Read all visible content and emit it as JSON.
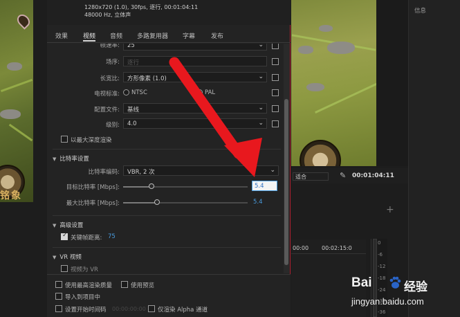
{
  "source_info": {
    "line1": "1280x720 (1.0), 30fps, 逐行, 00:01:04:11",
    "line2": "48000 Hz, 立体声"
  },
  "tabs": [
    "效果",
    "视频",
    "音频",
    "多路复用器",
    "字幕",
    "发布"
  ],
  "active_tab": "视频",
  "video": {
    "frame_rate_label": "帧速率:",
    "frame_rate_value": "25",
    "field_order_label": "场序:",
    "field_order_value": "逐行",
    "aspect_label": "长宽比:",
    "aspect_value": "方形像素 (1.0)",
    "tv_standard_label": "电视标准:",
    "ntsc": "NTSC",
    "pal": "PAL",
    "profile_label": "配置文件:",
    "profile_value": "基线",
    "level_label": "级别:",
    "level_value": "4.0",
    "max_depth": "以最大深度渲染"
  },
  "bitrate": {
    "title": "比特率设置",
    "encoding_label": "比特率编码:",
    "encoding_value": "VBR, 2 次",
    "target_label": "目标比特率 [Mbps]:",
    "target_value": "5.4",
    "max_label": "最大比特率 [Mbps]:",
    "max_value": "5.4"
  },
  "advanced": {
    "title": "高级设置",
    "keyframe_label": "关键帧距离:",
    "keyframe_value": "75"
  },
  "vr": {
    "title": "VR 视频",
    "vr_label": "视频为 VR"
  },
  "bottom": {
    "max_quality": "使用最高渲染质量",
    "use_preview": "使用预览",
    "import_project": "导入到项目中",
    "set_timecode": "设置开始时间码",
    "timecode_dim": "00:00:00:00",
    "render_alpha": "仅渲染 Alpha 通道"
  },
  "monitor": {
    "fit_value": "适合",
    "timecode": "00:01:04:11",
    "timeline_ticks": [
      "00:00",
      "00:02:15:0"
    ],
    "meter_levels": [
      "0",
      "-6",
      "-12",
      "-18",
      "-24",
      "-30",
      "-36"
    ]
  },
  "info_panel_title": "信息",
  "thumbnail_text": "铭象",
  "watermark": {
    "brand": "Bai",
    "brand_tail": "经验",
    "url": "jingyan.baidu.com"
  },
  "colors": {
    "accent_blue": "#4a9de0",
    "annotation_red": "#e8181e"
  }
}
